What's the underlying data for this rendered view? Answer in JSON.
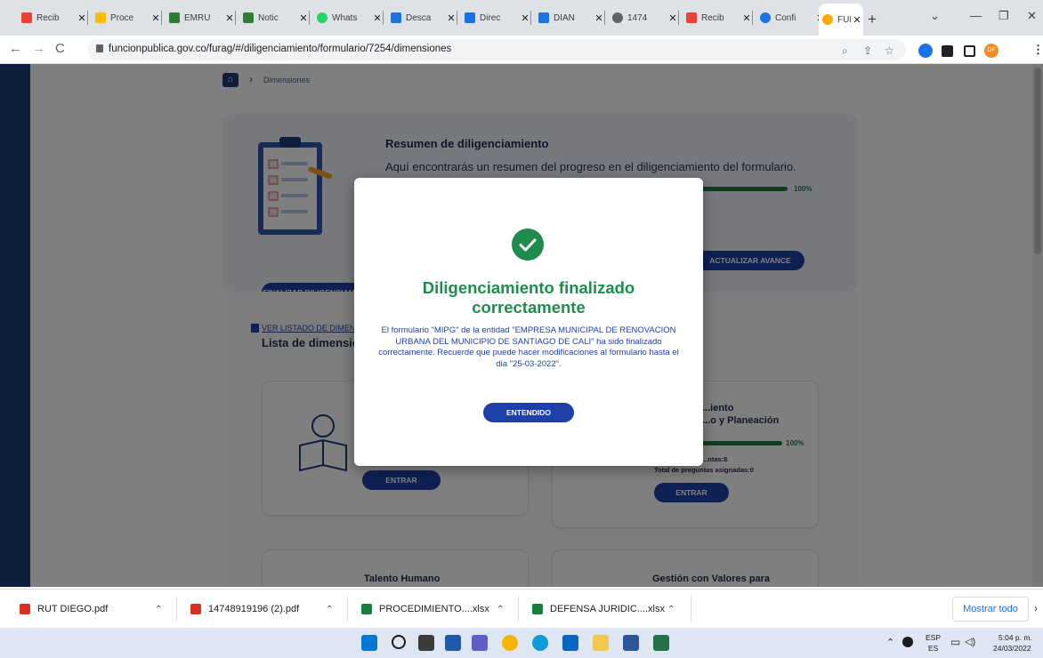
{
  "browser": {
    "tabs": [
      {
        "label": "Recib",
        "favicon_color": "#ea4335"
      },
      {
        "label": "Proce",
        "favicon_color": "#fbbc04"
      },
      {
        "label": "EMRU",
        "favicon_color": "#2e7d32"
      },
      {
        "label": "Notic",
        "favicon_color": "#2e7d32"
      },
      {
        "label": "Whats",
        "favicon_color": "#25d366"
      },
      {
        "label": "Desca",
        "favicon_color": "#1a73e8"
      },
      {
        "label": "Direc",
        "favicon_color": "#1a73e8"
      },
      {
        "label": "DIAN",
        "favicon_color": "#1a73e8"
      },
      {
        "label": "1474",
        "favicon_color": "#5f6368"
      },
      {
        "label": "Recib",
        "favicon_color": "#ea4335"
      },
      {
        "label": "Confi",
        "favicon_color": "#1a73e8"
      },
      {
        "label": "FURA",
        "favicon_color": "#f9ab00",
        "active": true
      }
    ],
    "url": "funcionpublica.gov.co/furag/#/diligenciamiento/formulario/7254/dimensiones"
  },
  "page": {
    "breadcrumb": "Dimensiones",
    "summary": {
      "title": "Resumen de diligenciamiento",
      "text": "Aquí encontrarás un resumen del progreso en el diligenciamiento del formulario.",
      "progress_pct": "100%",
      "progress_value": 1.0,
      "update_button": "ACTUALIZAR AVANCE",
      "finalize_button": "FINALIZAR DILIGENCIAMIENTO"
    },
    "list_link": "VER LISTADO DE DIMENSIONES",
    "list_title": "Lista de dimensiones",
    "cards": [
      {
        "title": "Talento Humano",
        "button": "ENTRAR"
      },
      {
        "title": "Direccionamiento Estratégico y Planeación",
        "title_line1": "...iento",
        "title_line2": "...o y Planeación",
        "pct": "100%",
        "meta1": "...ntas:8",
        "meta2": "Total de preguntas asignadas:0",
        "button": "ENTRAR"
      },
      {
        "title": "Talento Humano"
      },
      {
        "title": "Gestión con Valores para"
      }
    ]
  },
  "modal": {
    "title": "Diligenciamiento finalizado correctamente",
    "body": "El formulario \"MIPG\" de la entidad \"EMPRESA MUNICIPAL DE RENOVACION URBANA DEL MUNICIPIO DE SANTIAGO DE CALI\" ha sido finalizado correctamente. Recuerde que puede hacer modificaciones al formulario hasta el dia \"25-03-2022\".",
    "button": "ENTENDIDO"
  },
  "downloads": [
    {
      "name": "RUT DIEGO.pdf",
      "type": "pdf"
    },
    {
      "name": "14748919196 (2).pdf",
      "type": "pdf"
    },
    {
      "name": "PROCEDIMIENTO....xlsx",
      "type": "xlsx"
    },
    {
      "name": "DEFENSA JURIDIC....xlsx",
      "type": "xlsx"
    }
  ],
  "show_all": "Mostrar todo",
  "taskbar": {
    "lang1": "ESP",
    "lang2": "ES",
    "time": "5:04 p. m.",
    "date": "24/03/2022"
  },
  "avatar_initials": "DF"
}
